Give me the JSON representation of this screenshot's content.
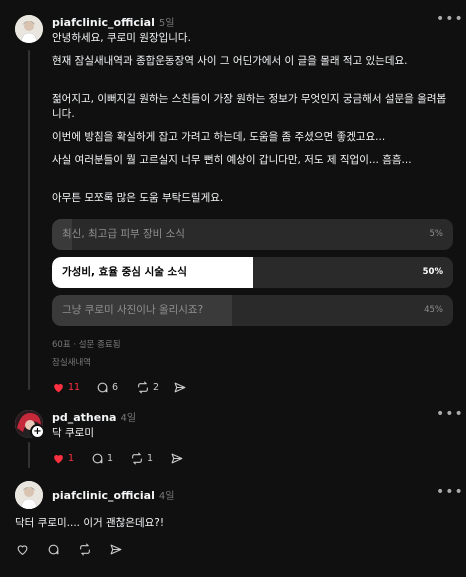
{
  "post": {
    "username": "piafclinic_official",
    "time": "5일",
    "more": "•••",
    "paragraphs": [
      "안녕하세요, 쿠로미 원장입니다.",
      "현재 잠실새내역과 종합운동장역 사이 그 어딘가에서 이 글을 몰래 적고 있는데요.",
      "젊어지고, 이뻐지길 원하는 스친들이 가장 원하는 정보가 무엇인지 궁금해서 설문을 올려봅니다.",
      "이번에 방침을 확실하게 잡고 가려고 하는데, 도움을 좀 주셨으면 좋겠고요...",
      "사실 여러분들이 뭘 고르실지 너무 뻔히 예상이 갑니다만, 저도 제 직업이... 흠흠...",
      "아무튼 모쪼록 많은 도움 부탁드릴게요."
    ],
    "poll": {
      "options": [
        {
          "label": "최신, 최고급 피부 장비 소식",
          "percent_label": "5%",
          "fraction": 0.05,
          "selected": false
        },
        {
          "label": "가성비, 효율 중심 시술 소식",
          "percent_label": "50%",
          "fraction": 0.5,
          "selected": true
        },
        {
          "label": "그냥 쿠로미 사진이나 올리시죠?",
          "percent_label": "45%",
          "fraction": 0.45,
          "selected": false
        }
      ],
      "summary": "60표 · 설문 종료됨"
    },
    "location": "잠실새내역",
    "likes": "11",
    "comments": "6",
    "reposts": "2"
  },
  "reply": {
    "username": "pd_athena",
    "time": "4일",
    "more": "•••",
    "text": "닥 쿠로미",
    "likes": "1",
    "comments": "1",
    "reposts": "1",
    "badge": "+"
  },
  "reply2": {
    "username": "piafclinic_official",
    "time": "4일",
    "more": "•••",
    "text": "닥터 쿠로미.... 이거 괜찮은데요?!"
  },
  "colors": {
    "background": "#101010",
    "liked": "#ff3040",
    "muted": "#777777"
  }
}
